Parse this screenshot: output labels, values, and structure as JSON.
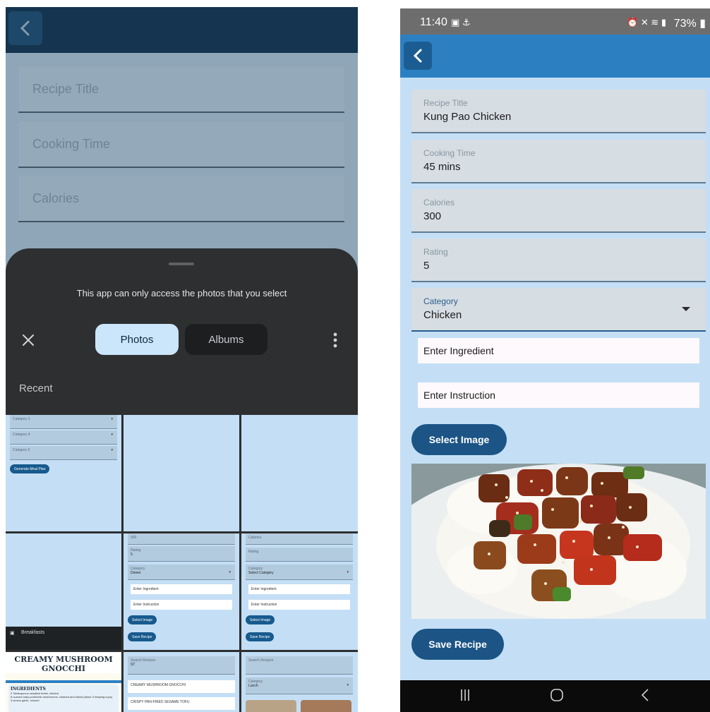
{
  "left_screen": {
    "form_placeholders": [
      "Recipe Title",
      "Cooking Time",
      "Calories"
    ],
    "picker": {
      "notice": "This app can only access the photos that you select",
      "tab_photos": "Photos",
      "tab_albums": "Albums",
      "section_label": "Recent"
    },
    "thumbnails": {
      "t1": {
        "fields": [
          "Category 3",
          "Category 4",
          "Category 5"
        ],
        "button": "Generate Meal Plan"
      },
      "t2": {
        "cal_value": "500",
        "rating_label": "Rating",
        "rating_value": "5",
        "category_label": "Category",
        "category_value": "Dinner",
        "ingredient": "Enter Ingredient",
        "instruction": "Enter Instruction",
        "select_image": "Select Image",
        "save_recipe": "Save Recipe"
      },
      "t3": {
        "calories_label": "Calories",
        "rating_label": "Rating",
        "category_label": "Category",
        "category_value": "Select Category",
        "ingredient": "Enter Ingredient",
        "instruction": "Enter Instruction",
        "select_image": "Select Image",
        "save_recipe": "Save Recipe"
      },
      "t4": {
        "label": "Breakfasts"
      },
      "t5": {
        "title": "CREAMY MUSHROOM GNOCCHI",
        "section": "INGREDIENTS",
        "lines": [
          "2 Tablespoons unsalted butter, divided",
          "8 ounces baby portobello mushrooms, cleaned and sliced (about 3 heaping cups)",
          "3 cloves garlic, minced"
        ]
      },
      "t6": {
        "search_label": "Search Recipes",
        "search_value": "ST",
        "items": [
          "CREAMY MUSHROOM GNOCCHI",
          "CRISPY PAN-FRIED SESAME TOFU"
        ]
      },
      "t7": {
        "search_label": "Search Recipes",
        "category_label": "Category",
        "category_value": "Lunch"
      }
    }
  },
  "right_screen": {
    "status": {
      "time": "11:40",
      "battery": "73%"
    },
    "fields": {
      "title": {
        "label": "Recipe Title",
        "value": "Kung Pao Chicken"
      },
      "time": {
        "label": "Cooking Time",
        "value": "45 mins"
      },
      "calories": {
        "label": "Calories",
        "value": "300"
      },
      "rating": {
        "label": "Rating",
        "value": "5"
      },
      "category": {
        "label": "Category",
        "value": "Chicken"
      }
    },
    "ingredient_placeholder": "Enter Ingredient",
    "instruction_placeholder": "Enter Instruction",
    "select_image": "Select Image",
    "save_recipe": "Save Recipe"
  },
  "colors": {
    "appbar": "#2c80c2",
    "button": "#1c5486",
    "background": "#c4dff5",
    "sheet": "#2d2f31"
  }
}
